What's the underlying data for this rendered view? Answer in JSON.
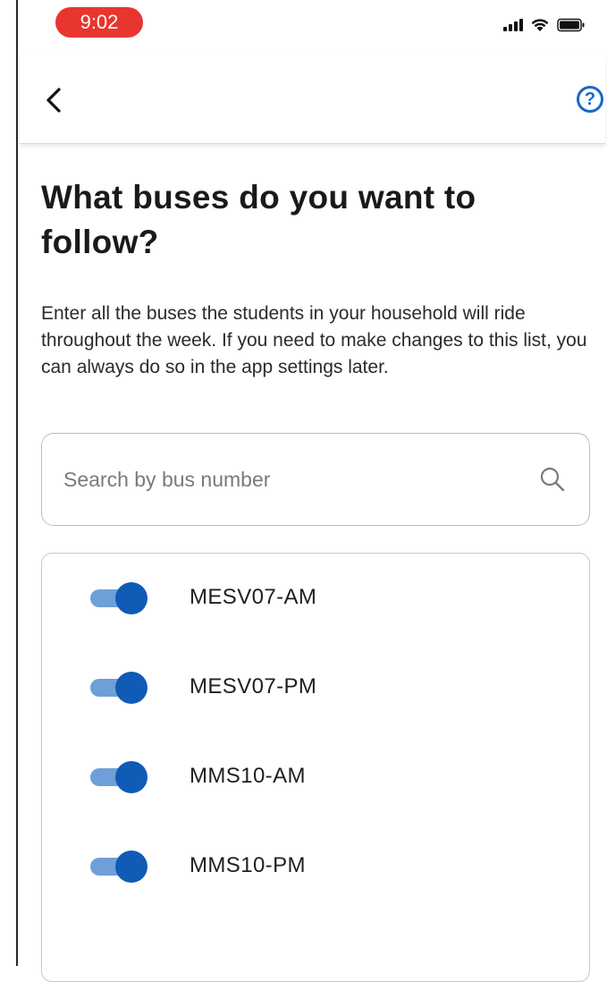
{
  "status_bar": {
    "time": "9:02"
  },
  "header": {
    "back_icon": "chevron-left-icon",
    "help_icon": "question-circle-icon",
    "help_glyph": "?"
  },
  "main": {
    "title": "What buses do you want to follow?",
    "description": "Enter all the buses the students in your household will ride throughout the week. If you need to make changes to this list, you can always do so in the app settings later.",
    "search": {
      "placeholder": "Search by bus number",
      "value": ""
    },
    "buses": [
      {
        "label": "MESV07-AM",
        "enabled": true
      },
      {
        "label": "MESV07-PM",
        "enabled": true
      },
      {
        "label": "MMS10-AM",
        "enabled": true
      },
      {
        "label": "MMS10-PM",
        "enabled": true
      }
    ]
  },
  "colors": {
    "time_pill": "#e8352f",
    "accent": "#1a66cc",
    "toggle_track": "#6f9fd8",
    "toggle_knob": "#0f5bb5"
  }
}
